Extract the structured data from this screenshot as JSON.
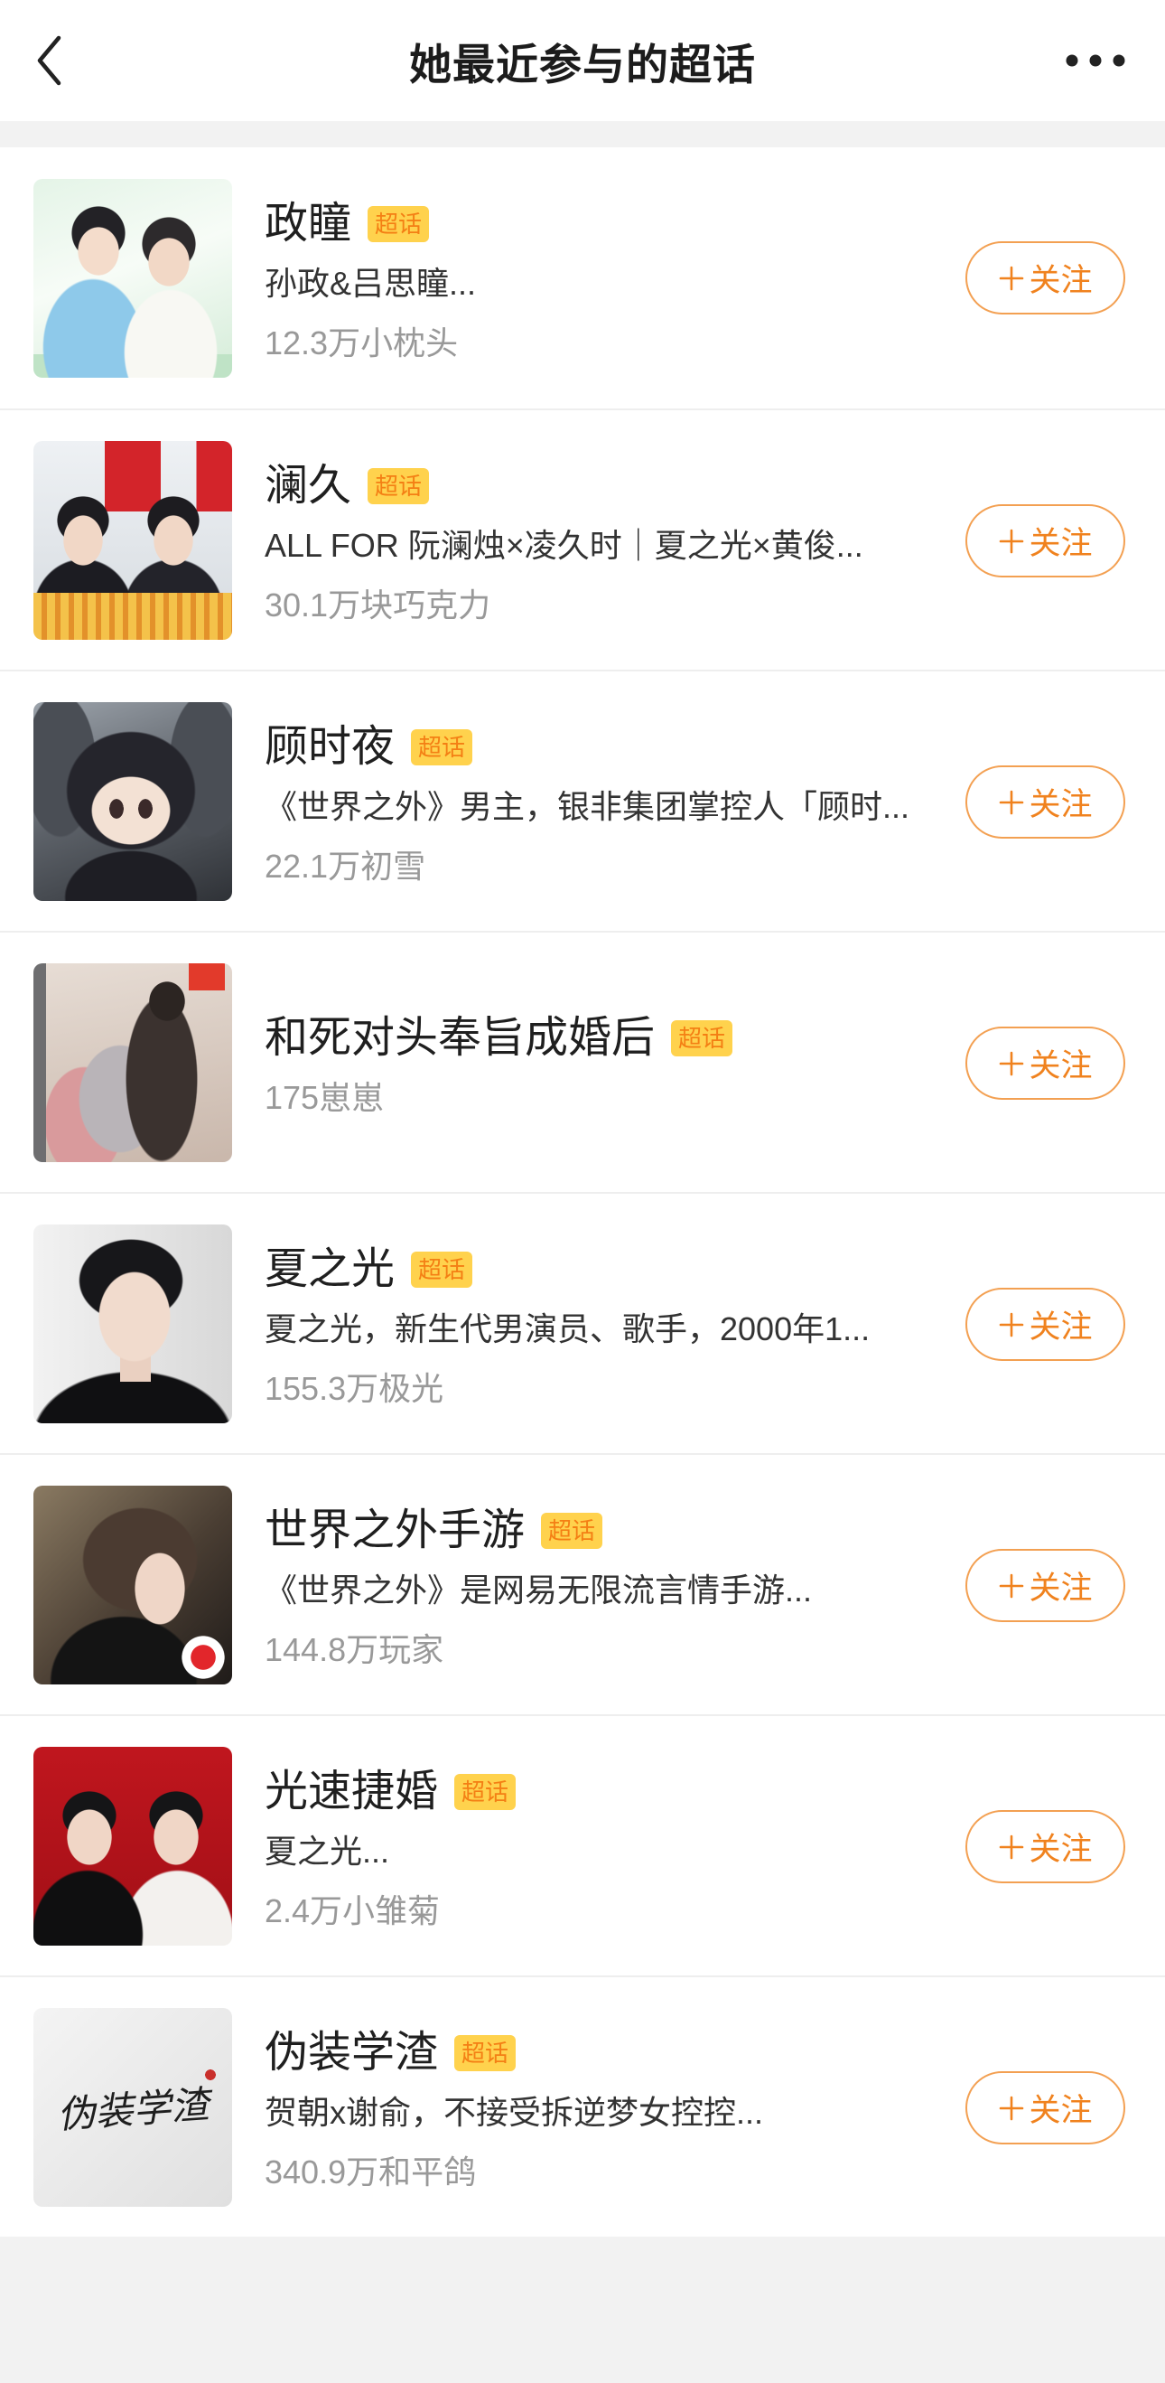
{
  "header": {
    "title": "她最近参与的超话",
    "back_icon": "chevron-left-icon",
    "more_icon": "more-dots-icon"
  },
  "colors": {
    "page_bg": "#f2f2f2",
    "accent": "#f0821e",
    "badge_bg": "#ffd24d",
    "badge_text": "#f47f14",
    "title_text": "#1f1f1f",
    "description_text": "#333333",
    "meta_text": "#999999"
  },
  "topics": [
    {
      "name": "政瞳",
      "badge": "超话",
      "description": "孙政&吕思瞳...",
      "fans": "12.3万小枕头",
      "follow_icon": "plus-icon",
      "follow_label": "关注"
    },
    {
      "name": "澜久",
      "badge": "超话",
      "description": "ALL FOR 阮澜烛×凌久时｜夏之光×黄俊...",
      "fans": "30.1万块巧克力",
      "follow_icon": "plus-icon",
      "follow_label": "关注"
    },
    {
      "name": "顾时夜",
      "badge": "超话",
      "description": "《世界之外》男主，银非集团掌控人「顾时...",
      "fans": "22.1万初雪",
      "follow_icon": "plus-icon",
      "follow_label": "关注"
    },
    {
      "name": "和死对头奉旨成婚后",
      "badge": "超话",
      "fans": "175崽崽",
      "follow_icon": "plus-icon",
      "follow_label": "关注"
    },
    {
      "name": "夏之光",
      "badge": "超话",
      "description": "夏之光，新生代男演员、歌手，2000年1...",
      "fans": "155.3万极光",
      "follow_icon": "plus-icon",
      "follow_label": "关注"
    },
    {
      "name": "世界之外手游",
      "badge": "超话",
      "description": "《世界之外》是网易无限流言情手游...",
      "fans": "144.8万玩家",
      "follow_icon": "plus-icon",
      "follow_label": "关注"
    },
    {
      "name": "光速捷婚",
      "badge": "超话",
      "description": "夏之光...",
      "fans": "2.4万小雏菊",
      "follow_icon": "plus-icon",
      "follow_label": "关注"
    },
    {
      "name": "伪装学渣",
      "badge": "超话",
      "description": "贺朝x谢俞，不接受拆逆梦女控控...",
      "fans": "340.9万和平鸽",
      "thumbnail_text": "伪装学渣",
      "follow_icon": "plus-icon",
      "follow_label": "关注"
    }
  ]
}
